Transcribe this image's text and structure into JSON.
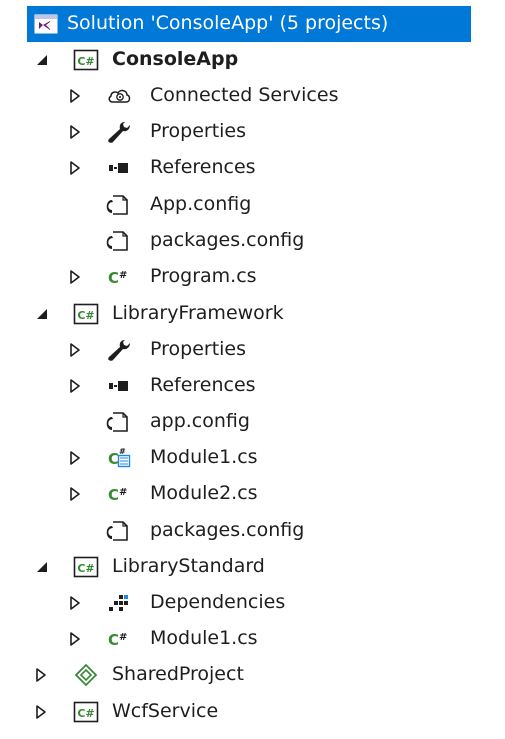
{
  "solution": {
    "label": "Solution 'ConsoleApp' (5 projects)"
  },
  "projects": {
    "console_app": {
      "label": "ConsoleApp",
      "items": {
        "connected_services": "Connected Services",
        "properties": "Properties",
        "references": "References",
        "app_config": "App.config",
        "packages_config": "packages.config",
        "program_cs": "Program.cs"
      }
    },
    "library_framework": {
      "label": "LibraryFramework",
      "items": {
        "properties": "Properties",
        "references": "References",
        "app_config": "app.config",
        "module1_cs": "Module1.cs",
        "module2_cs": "Module2.cs",
        "packages_config": "packages.config"
      }
    },
    "library_standard": {
      "label": "LibraryStandard",
      "items": {
        "dependencies": "Dependencies",
        "module1_cs": "Module1.cs"
      }
    },
    "shared_project": {
      "label": "SharedProject"
    },
    "wcf_service": {
      "label": "WcfService"
    }
  },
  "colors": {
    "selection": "#0078d7",
    "csharp_green": "#388a34",
    "text": "#1e1e1e"
  },
  "icons": {
    "solution": "visual-studio-solution-icon",
    "csharp_project": "csharp-project-icon",
    "csharp_file": "csharp-file-icon",
    "config_file": "config-file-icon",
    "properties": "wrench-icon",
    "references": "references-icon",
    "connected_services": "cloud-icon",
    "dependencies": "dependencies-icon",
    "shared_project": "shared-project-icon",
    "designer_file": "csharp-designer-icon"
  }
}
